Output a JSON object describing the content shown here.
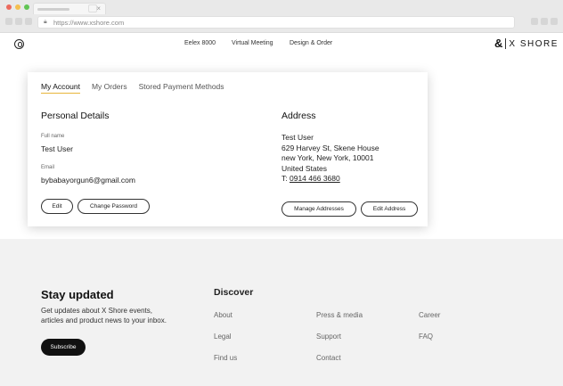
{
  "browser": {
    "url": "https://www.xshore.com",
    "colors": {
      "red": "#ec6a5e",
      "yellow": "#f4bf4f",
      "green": "#61c554"
    }
  },
  "header": {
    "nav": [
      "Eelex 8000",
      "Virtual Meeting",
      "Design & Order"
    ],
    "logo_mark": "&",
    "logo_text": "X SHORE",
    "user_icon": "user-circle-icon"
  },
  "account": {
    "tabs": [
      "My Account",
      "My Orders",
      "Stored Payment Methods"
    ],
    "personal": {
      "title": "Personal Details",
      "full_name_label": "Full name",
      "full_name": "Test User",
      "email_label": "Email",
      "email": "bybabayorgun6@gmail.com",
      "edit_label": "Edit",
      "change_password_label": "Change Password"
    },
    "address": {
      "title": "Address",
      "lines": [
        "Test User",
        "629 Harvey St, Skene House",
        "new York, New York, 10001",
        "United States"
      ],
      "phone_prefix": "T:",
      "phone": "0914 466 3680",
      "manage_label": "Manage Addresses",
      "edit_label": "Edit Address"
    },
    "accent_color": "#e8b53a"
  },
  "footer": {
    "title": "Stay updated",
    "text": "Get updates about X Shore events, articles and product news to your inbox.",
    "subscribe_label": "Subscribe",
    "discover_title": "Discover",
    "links": [
      "About",
      "Press & media",
      "Career",
      "Legal",
      "Support",
      "FAQ",
      "Find us",
      "Contact"
    ]
  }
}
